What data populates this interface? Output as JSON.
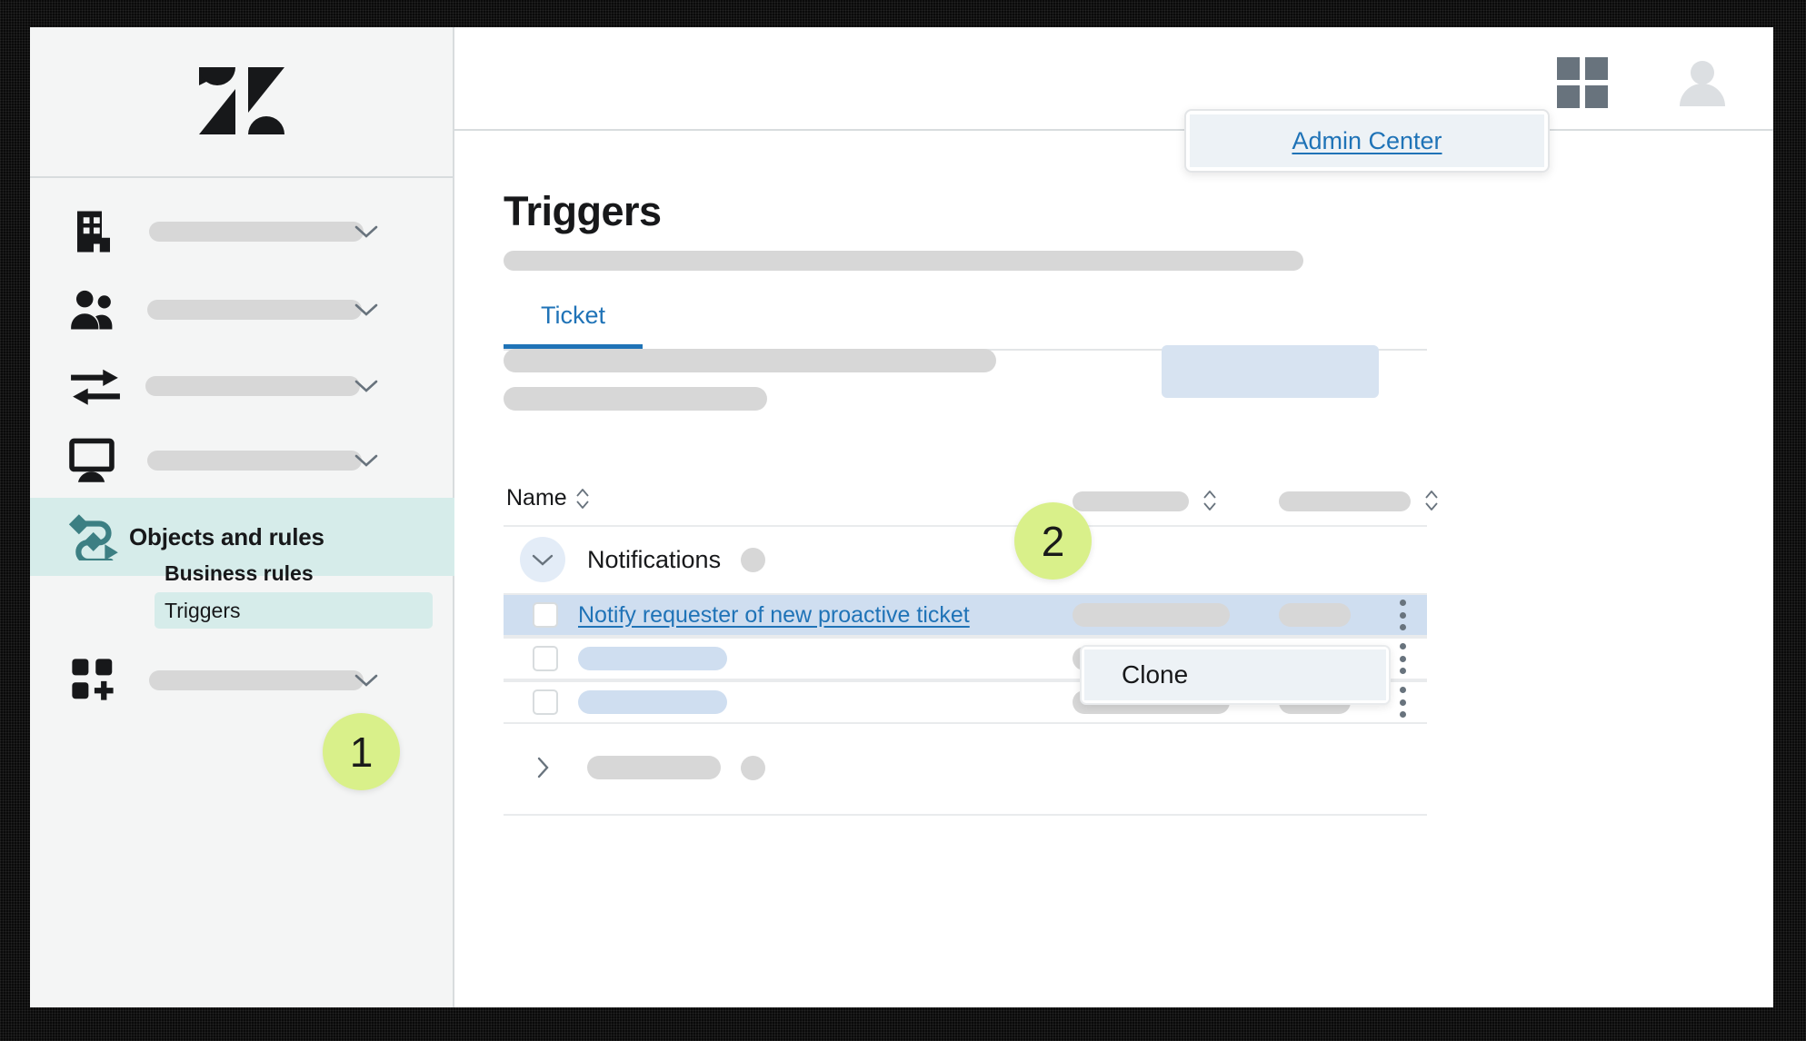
{
  "brand": {
    "logo_name": "zendesk-logo",
    "accent_blue": "#1f73b7",
    "active_teal": "#d6ecea",
    "callout_green": "#d9f08a"
  },
  "sidebar": {
    "items": [
      {
        "icon": "building-icon",
        "label": "",
        "has_chevron": true,
        "active": false
      },
      {
        "icon": "people-icon",
        "label": "",
        "has_chevron": true,
        "active": false
      },
      {
        "icon": "transfer-arrows-icon",
        "label": "",
        "has_chevron": true,
        "active": false
      },
      {
        "icon": "monitor-icon",
        "label": "",
        "has_chevron": true,
        "active": false
      },
      {
        "icon": "objects-rules-icon",
        "label": "Objects and rules",
        "has_chevron": false,
        "active": true
      },
      {
        "icon": "apps-add-icon",
        "label": "",
        "has_chevron": true,
        "active": false
      }
    ],
    "section_heading": "Business rules",
    "sub_items": [
      {
        "label": "Triggers",
        "selected": true
      }
    ]
  },
  "topbar": {
    "grid_icon": "grid-apps-icon",
    "avatar_icon": "user-avatar-icon",
    "popover": {
      "link_label": "Admin Center"
    }
  },
  "page": {
    "title": "Triggers",
    "tabs": [
      {
        "label": "Ticket",
        "active": true
      }
    ]
  },
  "table": {
    "columns": [
      {
        "label": "Name",
        "sortable": true
      },
      {
        "label": "",
        "sortable": true
      },
      {
        "label": "",
        "sortable": true
      }
    ],
    "groups": [
      {
        "label": "Notifications",
        "expanded": true,
        "rows": [
          {
            "name": "Notify requester of new proactive ticket",
            "is_link": true,
            "selected": true,
            "checked": false
          },
          {
            "name": "",
            "is_link": false,
            "selected": false,
            "checked": false
          },
          {
            "name": "",
            "is_link": false,
            "selected": false,
            "checked": false
          }
        ]
      },
      {
        "label": "",
        "expanded": false,
        "rows": []
      }
    ]
  },
  "context_menu": {
    "items": [
      {
        "label": "Clone",
        "highlighted": true
      }
    ]
  },
  "callouts": [
    {
      "number": "1"
    },
    {
      "number": "2"
    }
  ]
}
